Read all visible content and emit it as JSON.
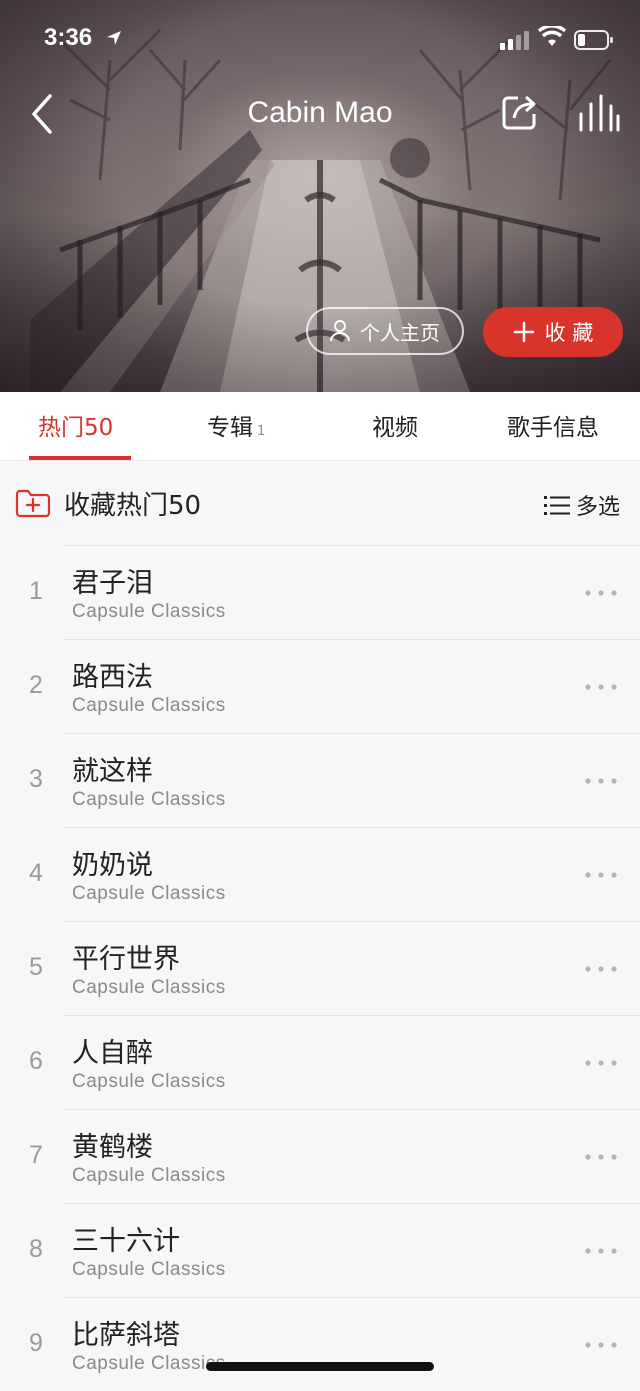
{
  "status_bar": {
    "time": "3:36"
  },
  "header": {
    "title": "Cabin Mao"
  },
  "hero_buttons": {
    "homepage_label": "个人主页",
    "collect_label": "收 藏"
  },
  "tabs": [
    {
      "label": "热门50",
      "count": ""
    },
    {
      "label": "专辑",
      "count": "1"
    },
    {
      "label": "视频",
      "count": ""
    },
    {
      "label": "歌手信息",
      "count": ""
    }
  ],
  "collect_row": {
    "label": "收藏热门50",
    "multi_select": "多选"
  },
  "songs": [
    {
      "index": "1",
      "title": "君子泪",
      "artist": "Capsule Classics"
    },
    {
      "index": "2",
      "title": "路西法",
      "artist": "Capsule Classics"
    },
    {
      "index": "3",
      "title": "就这样",
      "artist": "Capsule Classics"
    },
    {
      "index": "4",
      "title": "奶奶说",
      "artist": "Capsule Classics"
    },
    {
      "index": "5",
      "title": "平行世界",
      "artist": "Capsule Classics"
    },
    {
      "index": "6",
      "title": "人自醉",
      "artist": "Capsule Classics"
    },
    {
      "index": "7",
      "title": "黄鹤楼",
      "artist": "Capsule Classics"
    },
    {
      "index": "8",
      "title": "三十六计",
      "artist": "Capsule Classics"
    },
    {
      "index": "9",
      "title": "比萨斜塔",
      "artist": "Capsule Classics"
    }
  ],
  "colors": {
    "accent": "#d8342c",
    "text": "#222222",
    "subtext": "#8a8a8a"
  }
}
